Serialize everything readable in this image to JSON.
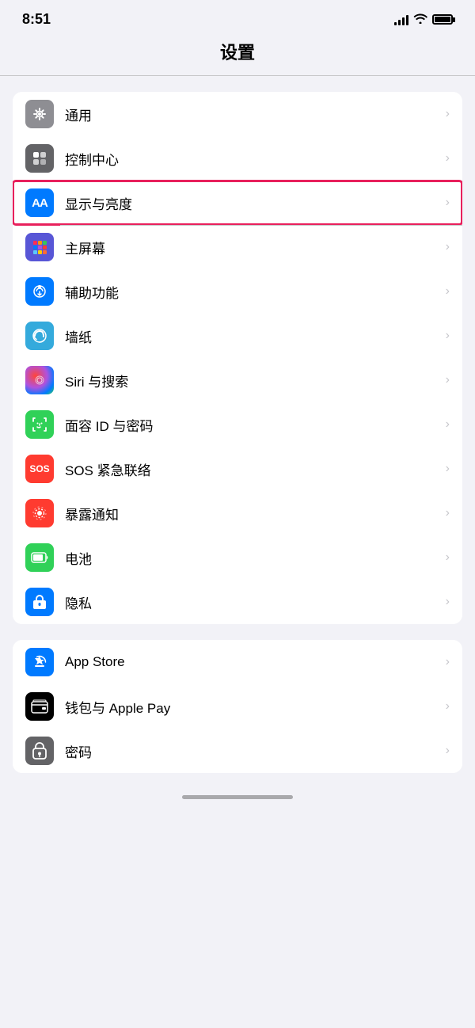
{
  "statusBar": {
    "time": "8:51",
    "icons": [
      "signal",
      "wifi",
      "battery"
    ]
  },
  "pageTitle": "设置",
  "group1": {
    "items": [
      {
        "id": "general",
        "label": "通用",
        "iconBg": "icon-general",
        "highlighted": false
      },
      {
        "id": "control-center",
        "label": "控制中心",
        "iconBg": "icon-control",
        "highlighted": false
      },
      {
        "id": "display",
        "label": "显示与亮度",
        "iconBg": "icon-display",
        "highlighted": true
      },
      {
        "id": "homescreen",
        "label": "主屏幕",
        "iconBg": "icon-homescreen",
        "highlighted": false
      },
      {
        "id": "accessibility",
        "label": "辅助功能",
        "iconBg": "icon-accessibility",
        "highlighted": false
      },
      {
        "id": "wallpaper",
        "label": "墙纸",
        "iconBg": "icon-wallpaper",
        "highlighted": false
      },
      {
        "id": "siri",
        "label": "Siri 与搜索",
        "iconBg": "icon-siri",
        "highlighted": false
      },
      {
        "id": "faceid",
        "label": "面容 ID 与密码",
        "iconBg": "icon-faceid",
        "highlighted": false
      },
      {
        "id": "sos",
        "label": "SOS 紧急联络",
        "iconBg": "icon-sos",
        "highlighted": false
      },
      {
        "id": "exposure",
        "label": "暴露通知",
        "iconBg": "icon-exposure",
        "highlighted": false
      },
      {
        "id": "battery",
        "label": "电池",
        "iconBg": "icon-battery",
        "highlighted": false
      },
      {
        "id": "privacy",
        "label": "隐私",
        "iconBg": "icon-privacy",
        "highlighted": false
      }
    ]
  },
  "group2": {
    "items": [
      {
        "id": "appstore",
        "label": "App Store",
        "iconBg": "icon-appstore",
        "highlighted": false
      },
      {
        "id": "wallet",
        "label": "钱包与 Apple Pay",
        "iconBg": "icon-wallet",
        "highlighted": false
      },
      {
        "id": "passwords",
        "label": "密码",
        "iconBg": "icon-passwords",
        "highlighted": false
      }
    ]
  },
  "chevronLabel": "›"
}
